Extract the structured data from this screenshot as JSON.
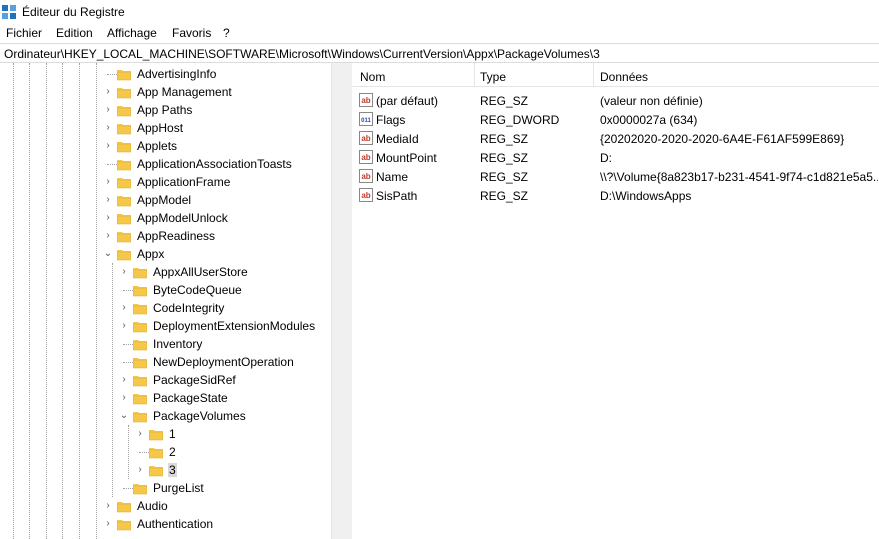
{
  "window": {
    "title": "Éditeur du Registre"
  },
  "menu": [
    "Fichier",
    "Edition",
    "Affichage",
    "Favoris",
    "?"
  ],
  "address": "Ordinateur\\HKEY_LOCAL_MACHINE\\SOFTWARE\\Microsoft\\Windows\\CurrentVersion\\Appx\\PackageVolumes\\3",
  "tree": {
    "items": [
      {
        "label": "AdvertisingInfo",
        "expander": ""
      },
      {
        "label": "App Management",
        "expander": "›"
      },
      {
        "label": "App Paths",
        "expander": "›"
      },
      {
        "label": "AppHost",
        "expander": "›"
      },
      {
        "label": "Applets",
        "expander": "›"
      },
      {
        "label": "ApplicationAssociationToasts",
        "expander": ""
      },
      {
        "label": "ApplicationFrame",
        "expander": "›"
      },
      {
        "label": "AppModel",
        "expander": "›"
      },
      {
        "label": "AppModelUnlock",
        "expander": "›"
      },
      {
        "label": "AppReadiness",
        "expander": "›"
      },
      {
        "label": "Appx",
        "expander": "⌄"
      },
      {
        "label": "AppxAllUserStore",
        "expander": "›"
      },
      {
        "label": "ByteCodeQueue",
        "expander": ""
      },
      {
        "label": "CodeIntegrity",
        "expander": "›"
      },
      {
        "label": "DeploymentExtensionModules",
        "expander": "›"
      },
      {
        "label": "Inventory",
        "expander": ""
      },
      {
        "label": "NewDeploymentOperation",
        "expander": ""
      },
      {
        "label": "PackageSidRef",
        "expander": "›"
      },
      {
        "label": "PackageState",
        "expander": "›"
      },
      {
        "label": "PackageVolumes",
        "expander": "⌄"
      },
      {
        "label": "1",
        "expander": "›"
      },
      {
        "label": "2",
        "expander": ""
      },
      {
        "label": "3",
        "expander": "›"
      },
      {
        "label": "PurgeList",
        "expander": ""
      },
      {
        "label": "Audio",
        "expander": "›"
      },
      {
        "label": "Authentication",
        "expander": "›"
      }
    ]
  },
  "list": {
    "headers": {
      "name": "Nom",
      "type": "Type",
      "data": "Données"
    },
    "rows": [
      {
        "icon": "string-value-icon",
        "glyph": "ab",
        "name": "(par défaut)",
        "type": "REG_SZ",
        "data": "(valeur non définie)"
      },
      {
        "icon": "binary-value-icon",
        "glyph": "011",
        "name": "Flags",
        "type": "REG_DWORD",
        "data": "0x0000027a (634)"
      },
      {
        "icon": "string-value-icon",
        "glyph": "ab",
        "name": "MediaId",
        "type": "REG_SZ",
        "data": "{20202020-2020-2020-6A4E-F61AF599E869}"
      },
      {
        "icon": "string-value-icon",
        "glyph": "ab",
        "name": "MountPoint",
        "type": "REG_SZ",
        "data": "D:"
      },
      {
        "icon": "string-value-icon",
        "glyph": "ab",
        "name": "Name",
        "type": "REG_SZ",
        "data": "\\\\?\\Volume{8a823b17-b231-4541-9f74-c1d821e5a5..."
      },
      {
        "icon": "string-value-icon",
        "glyph": "ab",
        "name": "SisPath",
        "type": "REG_SZ",
        "data": "D:\\WindowsApps"
      }
    ]
  },
  "colors": {
    "folder": "#f5c84a",
    "folder_dark": "#e0a526",
    "string_icon": "#c0392b",
    "binary_icon": "#1f4fa8"
  }
}
